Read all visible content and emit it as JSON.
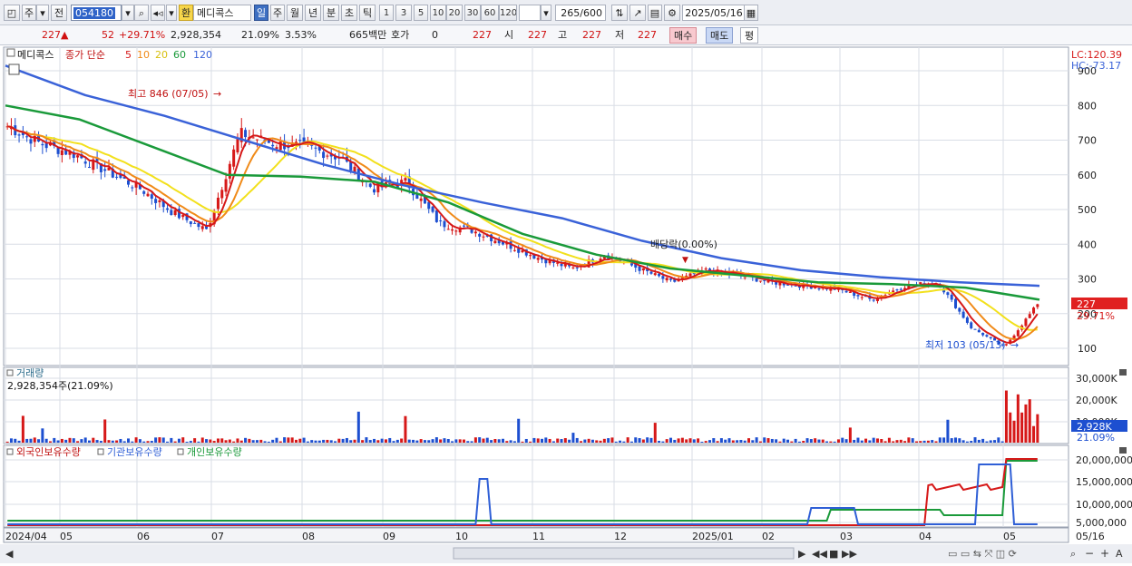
{
  "toolbar": {
    "mode_label": "주",
    "prev_label": "전",
    "stock_code": "054180",
    "han_label": "환",
    "stock_name": "메디콕스",
    "period_tabs": [
      "일",
      "주",
      "월",
      "년",
      "분",
      "초",
      "틱"
    ],
    "active_period": "일",
    "interval_values": [
      "1",
      "3",
      "5",
      "10",
      "20",
      "30",
      "60",
      "120"
    ],
    "count_display": "265",
    "count_total": "/600",
    "date_value": "2025/05/16"
  },
  "infobar": {
    "price": "227",
    "change": "52",
    "change_pct": "+29.71%",
    "volume": "2,928,354",
    "turnover_pct": "21.09%",
    "ratio_pct": "3.53%",
    "amount": "665백만",
    "quote_label": "호가",
    "quote_value": "0",
    "quote_price": "227",
    "open_label": "시",
    "open_value": "227",
    "high_label": "고",
    "high_value": "227",
    "low_label": "저",
    "low_value": "227",
    "buy_label": "매수",
    "sell_label": "매도",
    "flat_label": "평"
  },
  "price_panel": {
    "name_tag": "메디콕스",
    "legend_prefix": "종가 단순",
    "ma_labels": [
      "5",
      "10",
      "20",
      "60",
      "120"
    ],
    "ma_colors": [
      "#d61818",
      "#f08a18",
      "#f2e01c",
      "#1a9a3a",
      "#3a62d8"
    ],
    "lc_label": "LC:120.39",
    "hc_label": "HC:-73.17",
    "high_marker": "최고 846 (07/05)",
    "low_marker": "최저 103 (05/13)",
    "dividend_marker": "배당락(0.00%)",
    "price_tag": "227",
    "pct_tag": "29.71%"
  },
  "volume_panel": {
    "title": "거래량",
    "subtitle": "2,928,354주(21.09%)",
    "tag_value": "2,928K",
    "tag_pct": "21.09%"
  },
  "holdings_panel": {
    "legend": [
      "외국인보유수량",
      "기관보유수량",
      "개인보유수량"
    ],
    "legend_colors": [
      "#d61818",
      "#2f5fd6",
      "#1a9a3a"
    ]
  },
  "x_axis_labels": [
    "2024/04",
    "05",
    "06",
    "07",
    "08",
    "09",
    "10",
    "11",
    "12",
    "2025/01",
    "02",
    "03",
    "04",
    "05",
    "05/16"
  ],
  "colors": {
    "up": "#d61818",
    "down": "#1d4fd0",
    "grid": "#d9dde6"
  },
  "chart_data": {
    "type": "candlestick",
    "x_start": "2024/04",
    "x_end": "2025/05/16",
    "y_price_ticks": [
      100,
      200,
      300,
      400,
      500,
      600,
      700,
      800,
      900
    ],
    "y_volume_ticks": [
      "10,000K",
      "20,000K",
      "30,000K"
    ],
    "y_holdings_ticks": [
      "5,000,000",
      "10,000,000",
      "15,000,000",
      "20,000,000"
    ],
    "close_path": [
      [
        "2024/04",
        740
      ],
      [
        "2024/04b",
        690
      ],
      [
        "2024/05",
        660
      ],
      [
        "2024/05b",
        610
      ],
      [
        "2024/06",
        560
      ],
      [
        "2024/06b",
        490
      ],
      [
        "2024/06c",
        440
      ],
      [
        "2024/07",
        720
      ],
      [
        "2024/07b",
        690
      ],
      [
        "2024/07c",
        680
      ],
      [
        "2024/08",
        650
      ],
      [
        "2024/08b",
        560
      ],
      [
        "2024/08c",
        580
      ],
      [
        "2024/09",
        460
      ],
      [
        "2024/09b",
        440
      ],
      [
        "2024/10",
        400
      ],
      [
        "2024/10b",
        360
      ],
      [
        "2024/11",
        330
      ],
      [
        "2024/11b",
        370
      ],
      [
        "2024/12",
        330
      ],
      [
        "2024/12b",
        290
      ],
      [
        "2025/01",
        325
      ],
      [
        "2025/01b",
        310
      ],
      [
        "2025/02",
        290
      ],
      [
        "2025/02b",
        280
      ],
      [
        "2025/03",
        270
      ],
      [
        "2025/03b",
        240
      ],
      [
        "2025/04",
        280
      ],
      [
        "2025/04b",
        290
      ],
      [
        "2025/05",
        160
      ],
      [
        "2025/05b",
        103
      ],
      [
        "2025/05/16",
        227
      ]
    ],
    "ma120_path": [
      [
        "2024/04",
        915
      ],
      [
        "2024/06",
        830
      ],
      [
        "2024/07",
        770
      ],
      [
        "2024/08",
        700
      ],
      [
        "2024/09",
        630
      ],
      [
        "2024/10",
        570
      ],
      [
        "2024/11",
        520
      ],
      [
        "2024/12",
        475
      ],
      [
        "2025/01",
        410
      ],
      [
        "2025/02",
        360
      ],
      [
        "2025/03",
        325
      ],
      [
        "2025/04",
        305
      ],
      [
        "2025/05",
        290
      ],
      [
        "2025/05/16",
        280
      ]
    ],
    "ma60_path": [
      [
        "2024/04",
        800
      ],
      [
        "2024/05",
        760
      ],
      [
        "2024/06",
        680
      ],
      [
        "2024/07",
        600
      ],
      [
        "2024/08",
        595
      ],
      [
        "2024/09",
        580
      ],
      [
        "2024/10",
        520
      ],
      [
        "2024/11",
        430
      ],
      [
        "2024/12",
        370
      ],
      [
        "2025/01",
        330
      ],
      [
        "2025/02",
        310
      ],
      [
        "2025/03",
        290
      ],
      [
        "2025/04",
        285
      ],
      [
        "2025/05",
        275
      ],
      [
        "2025/05/16",
        240
      ]
    ],
    "high_price": {
      "label": "최고",
      "value": 846,
      "date": "07/05"
    },
    "low_price": {
      "label": "최저",
      "value": 103,
      "date": "05/13"
    },
    "last_close": 227,
    "last_change_pct": 29.71
  }
}
